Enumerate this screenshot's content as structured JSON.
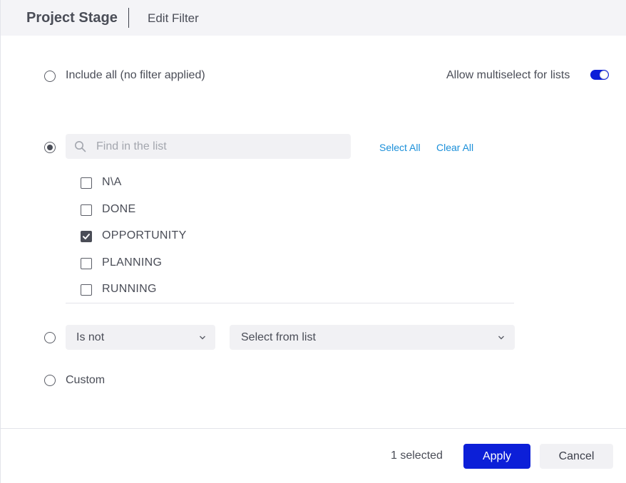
{
  "header": {
    "title": "Project Stage",
    "subtitle": "Edit Filter"
  },
  "options": {
    "include_all_label": "Include all (no filter applied)",
    "multiselect_label": "Allow multiselect for lists",
    "multiselect_enabled": true,
    "custom_label": "Custom"
  },
  "list_filter": {
    "search_placeholder": "Find in the list",
    "select_all": "Select All",
    "clear_all": "Clear All",
    "items": [
      {
        "label": "N\\A",
        "checked": false
      },
      {
        "label": "DONE",
        "checked": false
      },
      {
        "label": "OPPORTUNITY",
        "checked": true
      },
      {
        "label": "PLANNING",
        "checked": false
      },
      {
        "label": "RUNNING",
        "checked": false
      }
    ]
  },
  "condition_filter": {
    "operator": "Is not",
    "value_placeholder": "Select from list"
  },
  "footer": {
    "selected_text": "1 selected",
    "apply": "Apply",
    "cancel": "Cancel"
  },
  "colors": {
    "accent": "#0c1fd8",
    "link": "#1a8fd9",
    "header_bg": "#f4f4f7"
  }
}
